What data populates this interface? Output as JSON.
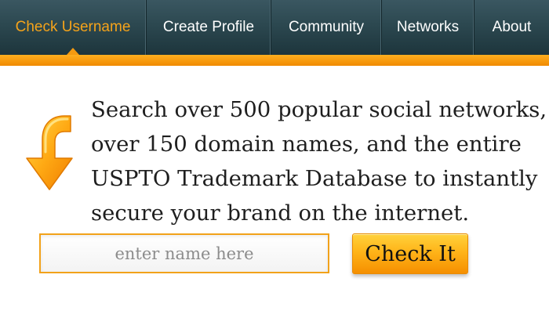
{
  "nav": {
    "items": [
      {
        "label": "Check Username",
        "active": true
      },
      {
        "label": "Create Profile",
        "active": false
      },
      {
        "label": "Community",
        "active": false
      },
      {
        "label": "Networks",
        "active": false
      },
      {
        "label": "About",
        "active": false
      }
    ]
  },
  "headline": {
    "lines": [
      "Search over 500 popular social networks,",
      "over 150 domain names, and the entire",
      "USPTO Trademark Database to instantly",
      "secure your brand on the internet."
    ]
  },
  "search": {
    "placeholder": "enter name here",
    "value": "",
    "button_label": "Check It"
  },
  "colors": {
    "nav_bg": "#2c4850",
    "accent_orange": "#f59a10",
    "active_nav_text": "#f5a31a",
    "button_top": "#ffd23c",
    "button_bottom": "#f58f00"
  },
  "icons": {
    "arrow": "curved-down-arrow-icon"
  }
}
